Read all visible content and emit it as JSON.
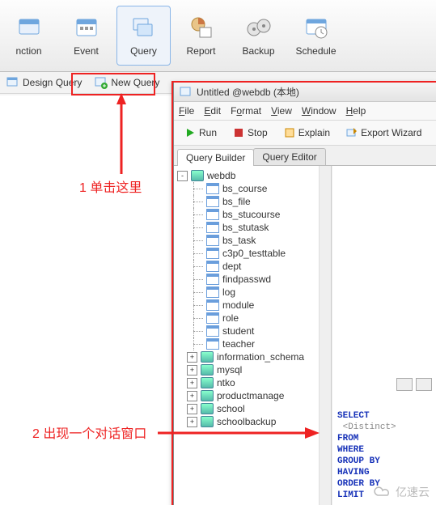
{
  "toolbar": {
    "items": [
      {
        "label": "nction",
        "active": false
      },
      {
        "label": "Event",
        "active": false
      },
      {
        "label": "Query",
        "active": true
      },
      {
        "label": "Report",
        "active": false
      },
      {
        "label": "Backup",
        "active": false
      },
      {
        "label": "Schedule",
        "active": false
      }
    ]
  },
  "sub_toolbar": {
    "design_query": "Design Query",
    "new_query": "New Query"
  },
  "annotations": {
    "one": "1 单击这里",
    "two": "2 出现一个对话窗口"
  },
  "dialog": {
    "title": "Untitled @webdb (本地)",
    "menu": [
      "File",
      "Edit",
      "Format",
      "View",
      "Window",
      "Help"
    ],
    "tools": {
      "run": "Run",
      "stop": "Stop",
      "explain": "Explain",
      "export": "Export Wizard"
    },
    "tabs": {
      "builder": "Query Builder",
      "editor": "Query Editor"
    }
  },
  "tree": {
    "root": "webdb",
    "tables": [
      "bs_course",
      "bs_file",
      "bs_stucourse",
      "bs_stutask",
      "bs_task",
      "c3p0_testtable",
      "dept",
      "findpasswd",
      "log",
      "module",
      "role",
      "student",
      "teacher"
    ],
    "other_dbs": [
      "information_schema",
      "mysql",
      "ntko",
      "productmanage",
      "school",
      "schoolbackup"
    ]
  },
  "sql": {
    "kws": [
      "SELECT",
      "FROM",
      "WHERE",
      "GROUP BY",
      "HAVING",
      "ORDER BY",
      "LIMIT"
    ],
    "distinct": "<Distinct>"
  },
  "watermark": "亿速云"
}
